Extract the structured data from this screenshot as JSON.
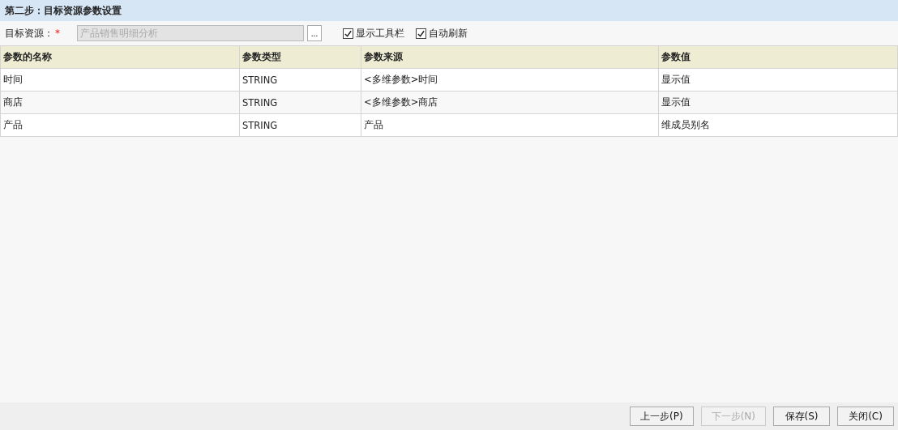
{
  "title": "第二步：目标资源参数设置",
  "target": {
    "label": "目标资源：",
    "required_mark": "*",
    "value": "产品销售明细分析",
    "disabled": true,
    "browse": "..."
  },
  "options": [
    {
      "label": "显示工具栏",
      "checked": true
    },
    {
      "label": "自动刷新",
      "checked": true
    }
  ],
  "table": {
    "columns": [
      "参数的名称",
      "参数类型",
      "参数来源",
      "参数值"
    ],
    "rows": [
      [
        "时间",
        "STRING",
        "<多维参数>时间",
        "显示值"
      ],
      [
        "商店",
        "STRING",
        "<多维参数>商店",
        "显示值"
      ],
      [
        "产品",
        "STRING",
        "产品",
        "维成员别名"
      ]
    ]
  },
  "buttons": [
    {
      "label": "上一步(P)",
      "disabled": false
    },
    {
      "label": "下一步(N)",
      "disabled": true
    },
    {
      "label": "保存(S)",
      "disabled": false
    },
    {
      "label": "关闭(C)",
      "disabled": false
    }
  ]
}
